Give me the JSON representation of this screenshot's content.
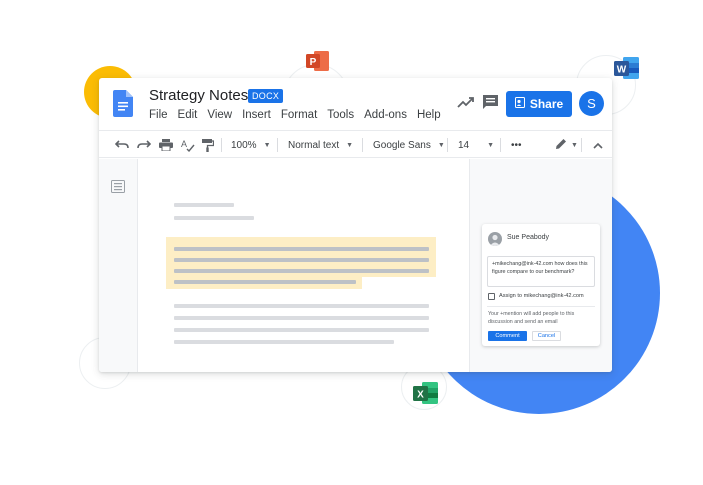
{
  "document": {
    "title": "Strategy Notes",
    "format_badge": "DOCX"
  },
  "menu": [
    "File",
    "Edit",
    "View",
    "Insert",
    "Format",
    "Tools",
    "Add-ons",
    "Help"
  ],
  "header": {
    "share_label": "Share",
    "avatar_initial": "S"
  },
  "toolbar": {
    "zoom": "100%",
    "style": "Normal text",
    "font": "Google Sans",
    "font_size": "14",
    "more": "•••"
  },
  "comment": {
    "author": "Sue Peabody",
    "text": "+mikechang@ink-42.com how does this figure compare to our benchmark?",
    "assign_label": "Assign to mikechang@ink-42.com",
    "note": "Your +mention will add people to this discussion and send an email",
    "comment_button": "Comment",
    "cancel_button": "Cancel"
  },
  "icons": {
    "app_logos": [
      "powerpoint-icon",
      "word-icon",
      "excel-icon"
    ],
    "header": [
      "docs-logo-icon",
      "activity-trend-icon",
      "comments-icon",
      "lock-share-icon"
    ],
    "toolbar": [
      "undo-icon",
      "redo-icon",
      "print-icon",
      "spellcheck-icon",
      "paint-format-icon",
      "pencil-edit-icon",
      "collapse-chevron-icon"
    ],
    "sidebar": [
      "document-outline-icon"
    ]
  },
  "colors": {
    "accent": "#1a73e8",
    "highlight": "#fce8b2",
    "blob_blue": "#4285f4",
    "blob_yellow": "#fbbc04",
    "powerpoint": "#d24726",
    "word": "#2b579a",
    "excel": "#217346"
  }
}
